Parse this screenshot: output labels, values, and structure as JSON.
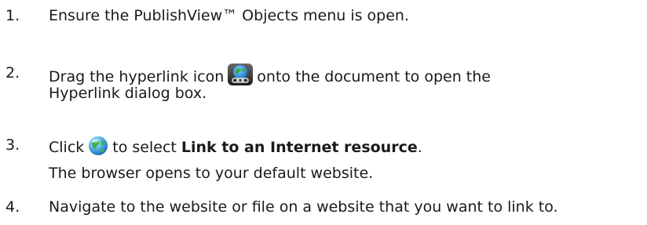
{
  "steps": [
    {
      "number": "1.",
      "text": "Ensure the PublishView™ Objects menu is open."
    },
    {
      "number": "2.",
      "text_before_icon": "Drag the hyperlink icon",
      "icon": "hyperlink-globe-chain-icon",
      "text_after_icon": "onto the document  to open the",
      "text_line2": "Hyperlink dialog box."
    },
    {
      "number": "3.",
      "text_before_icon": "Click",
      "icon": "internet-globe-icon",
      "text_after_icon": "to select",
      "bold_text": "Link to an Internet resource",
      "trailing": ".",
      "note": "The browser opens to your default website."
    },
    {
      "number": "4.",
      "text": "Navigate to the website or file on a website that you want to link to."
    }
  ]
}
